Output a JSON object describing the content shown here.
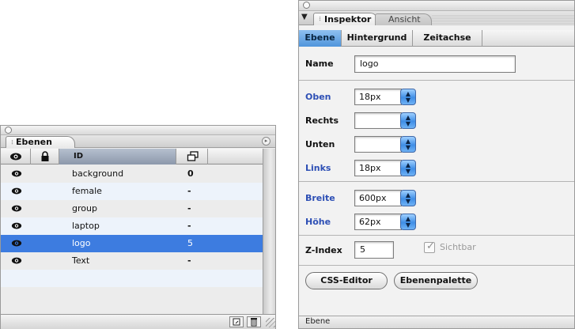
{
  "layers_panel": {
    "tab_label": "Ebenen",
    "columns": {
      "id": "ID"
    },
    "rows": [
      {
        "id": "background",
        "z": "0",
        "selected": false
      },
      {
        "id": "female",
        "z": "-",
        "selected": false
      },
      {
        "id": "group",
        "z": "-",
        "selected": false
      },
      {
        "id": "laptop",
        "z": "-",
        "selected": false
      },
      {
        "id": "logo",
        "z": "5",
        "selected": true
      },
      {
        "id": "Text",
        "z": "-",
        "selected": false
      }
    ]
  },
  "inspector": {
    "tab_active": "Inspektor",
    "tab_inactive": "Ansicht",
    "segments": [
      "Ebene",
      "Hintergrund",
      "Zeitachse"
    ],
    "name_label": "Name",
    "name_value": "logo",
    "position": {
      "oben_label": "Oben",
      "oben_value": "18px",
      "rechts_label": "Rechts",
      "rechts_value": "",
      "unten_label": "Unten",
      "unten_value": "",
      "links_label": "Links",
      "links_value": "18px"
    },
    "size": {
      "breite_label": "Breite",
      "breite_value": "600px",
      "hoehe_label": "Höhe",
      "hoehe_value": "62px"
    },
    "zindex_label": "Z-Index",
    "zindex_value": "5",
    "sichtbar_label": "Sichtbar",
    "css_editor_button": "CSS-Editor",
    "ebenenpalette_button": "Ebenenpalette",
    "footer": "Ebene"
  }
}
